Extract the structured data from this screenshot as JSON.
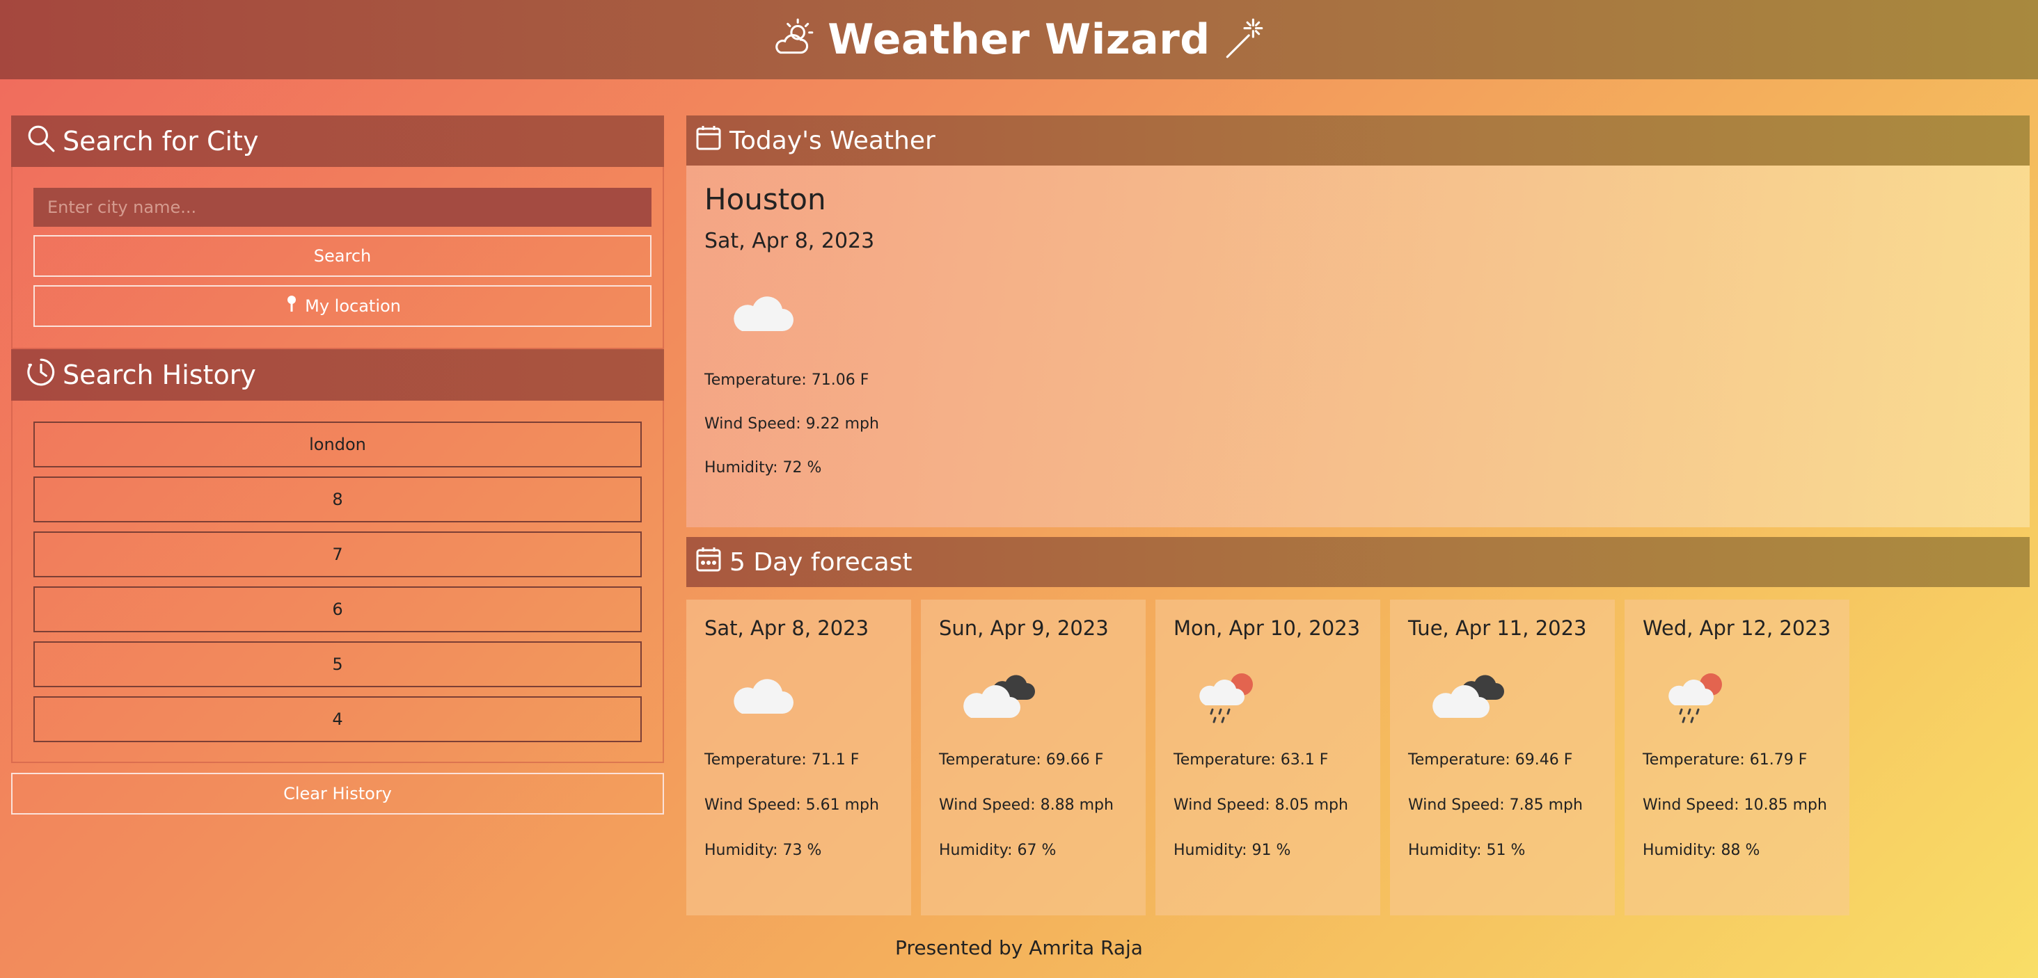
{
  "header": {
    "title": "Weather Wizard",
    "left_icon": "partly-cloudy-icon",
    "right_icon": "magic-wand-icon"
  },
  "search": {
    "heading": "Search for City",
    "placeholder": "Enter city name...",
    "search_label": "Search",
    "location_label": "My location"
  },
  "history": {
    "heading": "Search History",
    "items": [
      "london",
      "8",
      "7",
      "6",
      "5",
      "4"
    ],
    "clear_label": "Clear History"
  },
  "today": {
    "heading": "Today's Weather",
    "city": "Houston",
    "date": "Sat, Apr 8, 2023",
    "icon": "cloud-icon",
    "temperature": "Temperature: 71.06 F",
    "wind": "Wind Speed: 9.22 mph",
    "humidity": "Humidity: 72 %"
  },
  "forecast": {
    "heading": "5 Day forecast",
    "days": [
      {
        "date": "Sat, Apr 8, 2023",
        "icon": "cloud-icon",
        "temperature": "Temperature: 71.1 F",
        "wind": "Wind Speed: 5.61 mph",
        "humidity": "Humidity: 73 %"
      },
      {
        "date": "Sun, Apr 9, 2023",
        "icon": "broken-clouds-icon",
        "temperature": "Temperature: 69.66 F",
        "wind": "Wind Speed: 8.88 mph",
        "humidity": "Humidity: 67 %"
      },
      {
        "date": "Mon, Apr 10, 2023",
        "icon": "rain-sun-icon",
        "temperature": "Temperature: 63.1 F",
        "wind": "Wind Speed: 8.05 mph",
        "humidity": "Humidity: 91 %"
      },
      {
        "date": "Tue, Apr 11, 2023",
        "icon": "broken-clouds-icon",
        "temperature": "Temperature: 69.46 F",
        "wind": "Wind Speed: 7.85 mph",
        "humidity": "Humidity: 51 %"
      },
      {
        "date": "Wed, Apr 12, 2023",
        "icon": "rain-sun-icon",
        "temperature": "Temperature: 61.79 F",
        "wind": "Wind Speed: 10.85 mph",
        "humidity": "Humidity: 88 %"
      }
    ]
  },
  "footer": {
    "text": "Presented by Amrita Raja"
  }
}
